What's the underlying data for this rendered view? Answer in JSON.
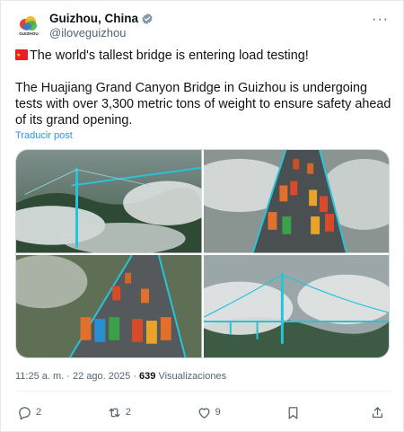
{
  "post": {
    "display_name": "Guizhou, China",
    "handle": "@iloveguizhou",
    "avatar_text": "GUIZHOU",
    "verified_icon": "verified-badge-icon",
    "more_icon": "more-horizontal-icon",
    "headline": "The world's tallest bridge is entering load testing!",
    "body": "The Huajiang Grand Canyon Bridge in Guizhou is undergoing tests with over 3,300 metric tons of weight to ensure safety ahead of its grand opening.",
    "translate_label": "Traducir post",
    "time": "11:25 a. m.",
    "separator": "·",
    "date": "22 ago. 2025",
    "views_count": "639",
    "views_label": "Visualizaciones"
  },
  "actions": {
    "replies": "2",
    "reposts": "2",
    "likes": "9"
  },
  "colors": {
    "accent": "#1d9bf0",
    "muted": "#536471",
    "bridge_cyan": "#27c4d8"
  }
}
